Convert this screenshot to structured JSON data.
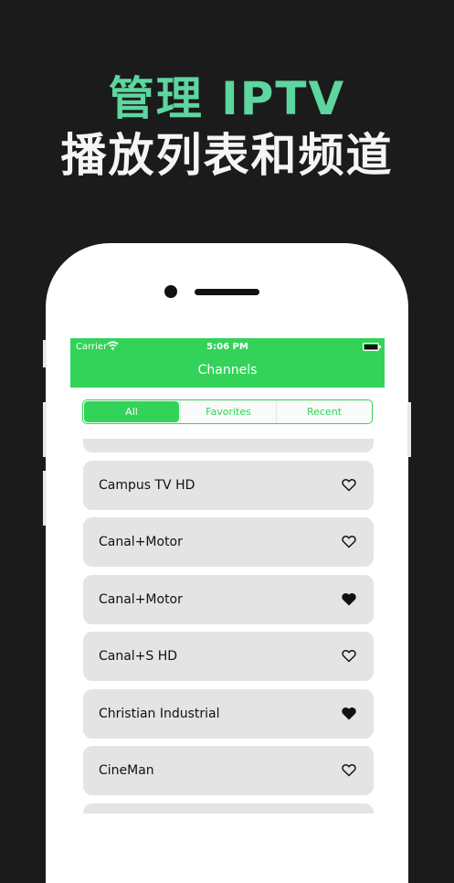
{
  "promo": {
    "line1": "管理 IPTV",
    "line2": "播放列表和频道",
    "line1_color": "#5dd6a0",
    "line2_color": "#f5f5f5"
  },
  "status_bar": {
    "carrier": "Carrier",
    "time": "5:06 PM"
  },
  "nav": {
    "title": "Channels",
    "accent": "#33d35a"
  },
  "segments": [
    {
      "label": "All",
      "selected": true
    },
    {
      "label": "Favorites",
      "selected": false
    },
    {
      "label": "Recent",
      "selected": false
    }
  ],
  "channels": [
    {
      "name": "Campus TV HD",
      "favorite": false,
      "icon": "heart-outline-icon"
    },
    {
      "name": "Canal+Motor",
      "favorite": false,
      "icon": "heart-outline-icon"
    },
    {
      "name": "Canal+Motor",
      "favorite": true,
      "icon": "heart-filled-icon"
    },
    {
      "name": "Canal+S HD",
      "favorite": false,
      "icon": "heart-outline-icon"
    },
    {
      "name": "Christian Industrial",
      "favorite": true,
      "icon": "heart-filled-icon"
    },
    {
      "name": "CineMan",
      "favorite": false,
      "icon": "heart-outline-icon"
    }
  ]
}
